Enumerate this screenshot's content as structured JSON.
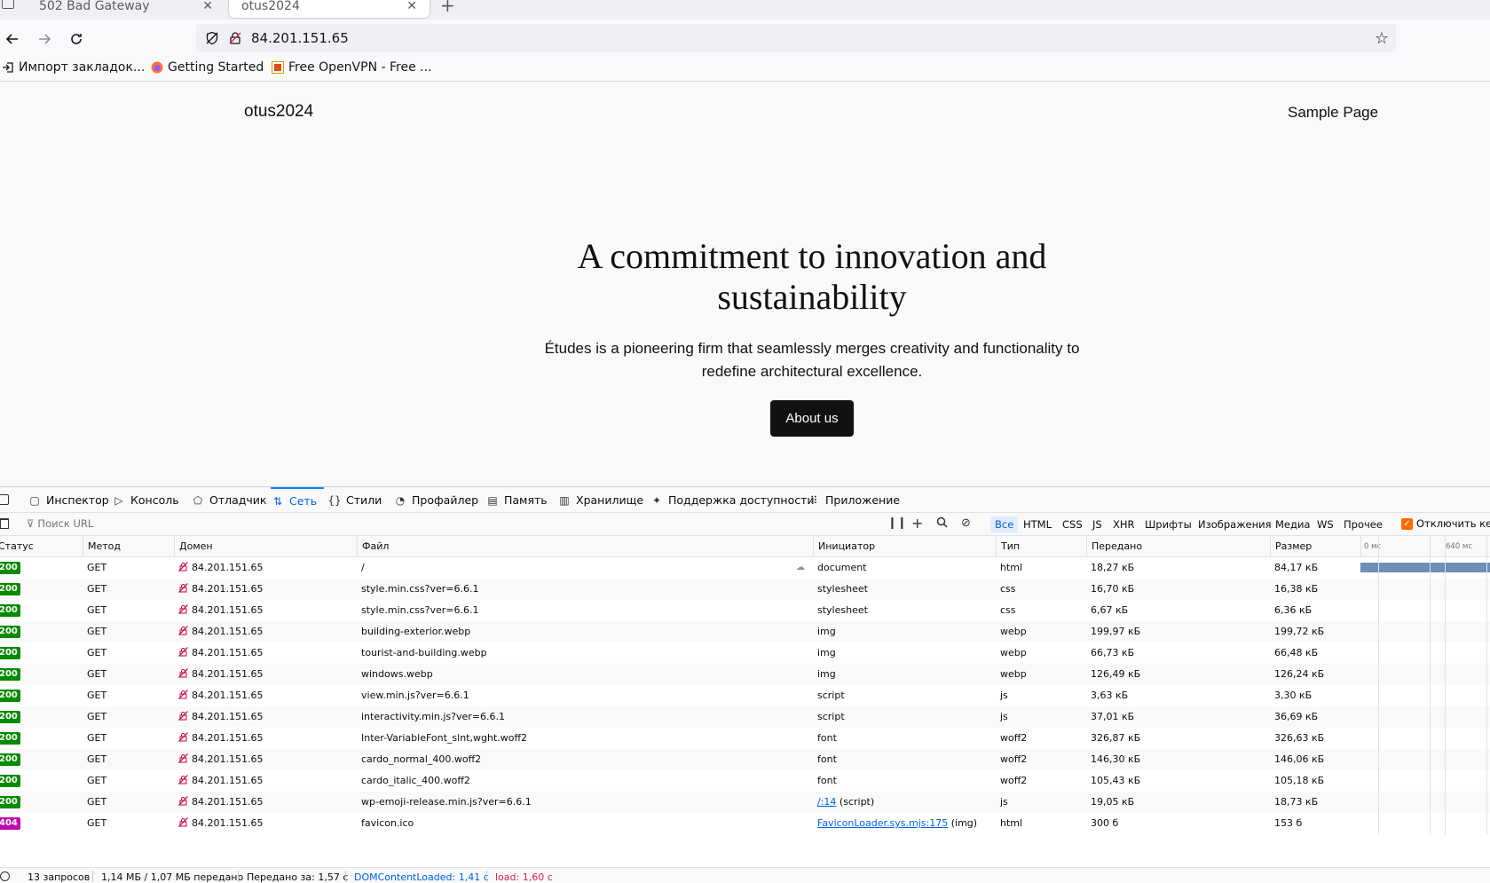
{
  "browser": {
    "tabs": [
      {
        "title": "502 Bad Gateway",
        "active": false
      },
      {
        "title": "otus2024",
        "active": true
      }
    ],
    "url": "84.201.151.65",
    "bookmarks": [
      "Импорт закладок...",
      "Getting Started",
      "Free OpenVPN - Free ..."
    ]
  },
  "site": {
    "title": "otus2024",
    "nav_link": "Sample Page",
    "hero_title": "A commitment to innovation and sustainability",
    "hero_text": "Études is a pioneering firm that seamlessly merges creativity and functionality to redefine architectural excellence.",
    "button": "About us"
  },
  "devtools": {
    "tabs": [
      "Инспектор",
      "Консоль",
      "Отладчик",
      "Сеть",
      "Стили",
      "Профайлер",
      "Память",
      "Хранилище",
      "Поддержка доступности",
      "Приложение"
    ],
    "selected_tab": "Сеть",
    "filter_placeholder": "Поиск URL",
    "type_filters": [
      "Все",
      "HTML",
      "CSS",
      "JS",
      "XHR",
      "Шрифты",
      "Изображения",
      "Медиа",
      "WS",
      "Прочее"
    ],
    "selected_type": "Все",
    "disable_cache_label": "Отключить кеш",
    "columns": [
      "Статус",
      "Метод",
      "Домен",
      "Файл",
      "Инициатор",
      "Тип",
      "Передано",
      "Размер"
    ],
    "waterfall_ticks": [
      "0 мс",
      "640 мс"
    ],
    "rows": [
      {
        "status": "200",
        "method": "GET",
        "domain": "84.201.151.65",
        "file": "/",
        "initiator": "document",
        "initiator_link": "",
        "type": "html",
        "transferred": "18,27 кБ",
        "size": "84,17 кБ"
      },
      {
        "status": "200",
        "method": "GET",
        "domain": "84.201.151.65",
        "file": "style.min.css?ver=6.6.1",
        "initiator": "stylesheet",
        "initiator_link": "",
        "type": "css",
        "transferred": "16,70 кБ",
        "size": "16,38 кБ"
      },
      {
        "status": "200",
        "method": "GET",
        "domain": "84.201.151.65",
        "file": "style.min.css?ver=6.6.1",
        "initiator": "stylesheet",
        "initiator_link": "",
        "type": "css",
        "transferred": "6,67 кБ",
        "size": "6,36 кБ"
      },
      {
        "status": "200",
        "method": "GET",
        "domain": "84.201.151.65",
        "file": "building-exterior.webp",
        "initiator": "img",
        "initiator_link": "",
        "type": "webp",
        "transferred": "199,97 кБ",
        "size": "199,72 кБ"
      },
      {
        "status": "200",
        "method": "GET",
        "domain": "84.201.151.65",
        "file": "tourist-and-building.webp",
        "initiator": "img",
        "initiator_link": "",
        "type": "webp",
        "transferred": "66,73 кБ",
        "size": "66,48 кБ"
      },
      {
        "status": "200",
        "method": "GET",
        "domain": "84.201.151.65",
        "file": "windows.webp",
        "initiator": "img",
        "initiator_link": "",
        "type": "webp",
        "transferred": "126,49 кБ",
        "size": "126,24 кБ"
      },
      {
        "status": "200",
        "method": "GET",
        "domain": "84.201.151.65",
        "file": "view.min.js?ver=6.6.1",
        "initiator": "script",
        "initiator_link": "",
        "type": "js",
        "transferred": "3,63 кБ",
        "size": "3,30 кБ"
      },
      {
        "status": "200",
        "method": "GET",
        "domain": "84.201.151.65",
        "file": "interactivity.min.js?ver=6.6.1",
        "initiator": "script",
        "initiator_link": "",
        "type": "js",
        "transferred": "37,01 кБ",
        "size": "36,69 кБ"
      },
      {
        "status": "200",
        "method": "GET",
        "domain": "84.201.151.65",
        "file": "Inter-VariableFont_slnt,wght.woff2",
        "initiator": "font",
        "initiator_link": "",
        "type": "woff2",
        "transferred": "326,87 кБ",
        "size": "326,63 кБ"
      },
      {
        "status": "200",
        "method": "GET",
        "domain": "84.201.151.65",
        "file": "cardo_normal_400.woff2",
        "initiator": "font",
        "initiator_link": "",
        "type": "woff2",
        "transferred": "146,30 кБ",
        "size": "146,06 кБ"
      },
      {
        "status": "200",
        "method": "GET",
        "domain": "84.201.151.65",
        "file": "cardo_italic_400.woff2",
        "initiator": "font",
        "initiator_link": "",
        "type": "woff2",
        "transferred": "105,43 кБ",
        "size": "105,18 кБ"
      },
      {
        "status": "200",
        "method": "GET",
        "domain": "84.201.151.65",
        "file": "wp-emoji-release.min.js?ver=6.6.1",
        "initiator": " (script)",
        "initiator_link": "/:14",
        "type": "js",
        "transferred": "19,05 кБ",
        "size": "18,73 кБ"
      },
      {
        "status": "404",
        "method": "GET",
        "domain": "84.201.151.65",
        "file": "favicon.ico",
        "initiator": " (img)",
        "initiator_link": "FaviconLoader.sys.mjs:175",
        "type": "html",
        "transferred": "300 б",
        "size": "153 б"
      }
    ],
    "summary": {
      "requests": "13 запросов",
      "transferred": "1,14 МБ / 1,07 МБ передано",
      "finish": "Передано за: 1,57 с",
      "dom_loaded": "DOMContentLoaded: 1,41 с",
      "load": "load: 1,60 с"
    }
  },
  "colors": {
    "status_ok": "#058b00",
    "status_error": "#c00bb1",
    "devtools_accent": "#0060df",
    "button_bg": "#111111"
  }
}
